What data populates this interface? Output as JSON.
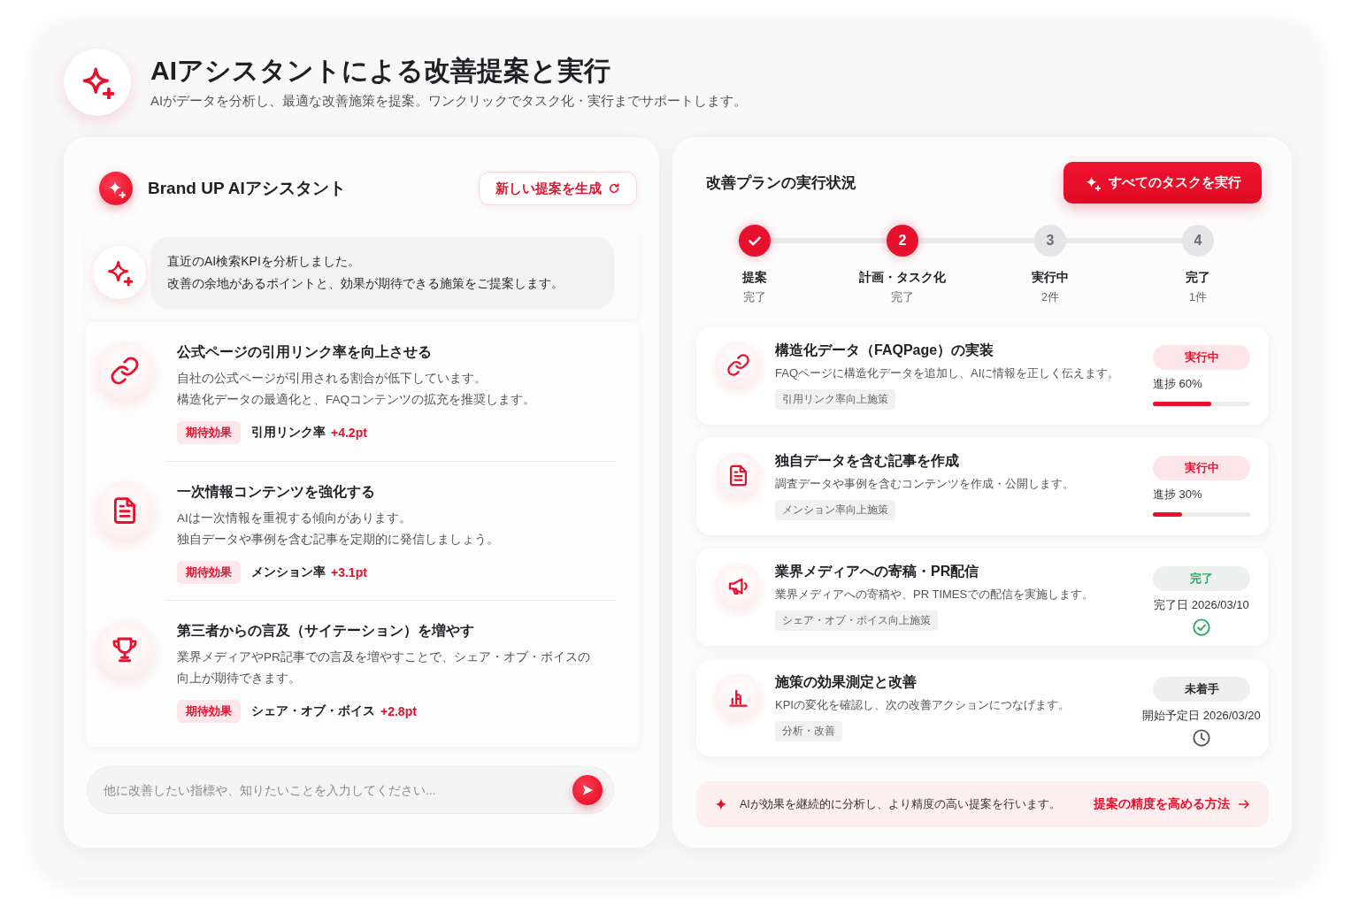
{
  "header": {
    "title": "AIアシスタントによる改善提案と実行",
    "subtitle": "AIがデータを分析し、最適な改善施策を提案。ワンクリックでタスク化・実行までサポートします。"
  },
  "assistant": {
    "name": "Brand UP AIアシスタント",
    "generate_button": "新しい提案を生成",
    "message": [
      "直近のAI検索KPIを分析しました。",
      "改善の余地があるポイントと、効果が期待できる施策をご提案します。"
    ],
    "suggestions": [
      {
        "title": "公式ページの引用リンク率を向上させる",
        "description": [
          "自社の公式ページが引用される割合が低下しています。",
          "構造化データの最適化と、FAQコンテンツの拡充を推奨します。"
        ],
        "effect_label": "期待効果",
        "metric": "引用リンク率",
        "delta": "+4.2pt"
      },
      {
        "title": "一次情報コンテンツを強化する",
        "description": [
          "AIは一次情報を重視する傾向があります。",
          "独自データや事例を含む記事を定期的に発信しましょう。"
        ],
        "effect_label": "期待効果",
        "metric": "メンション率",
        "delta": "+3.1pt"
      },
      {
        "title": "第三者からの言及（サイテーション）を増やす",
        "description": [
          "業界メディアやPR記事での言及を増やすことで、シェア・オブ・ボイスの向上が期待できます。"
        ],
        "effect_label": "期待効果",
        "metric": "シェア・オブ・ボイス",
        "delta": "+2.8pt"
      }
    ],
    "input": {
      "placeholder": "他に改善したい指標や、知りたいことを入力してください..."
    }
  },
  "plan": {
    "title": "改善プランの実行状況",
    "run_all_button": "すべてのタスクを実行",
    "steps": [
      {
        "done": true,
        "active": true,
        "label": "提案",
        "sub": "完了"
      },
      {
        "done": false,
        "active": true,
        "number": "2",
        "label": "計画・タスク化",
        "sub": "完了"
      },
      {
        "done": false,
        "active": false,
        "number": "3",
        "label": "実行中",
        "sub": "2件"
      },
      {
        "done": false,
        "active": false,
        "number": "4",
        "label": "完了",
        "sub": "1件"
      }
    ],
    "tasks": [
      {
        "kind": "progress",
        "title": "構造化データ（FAQPage）の実装",
        "description": "FAQページに構造化データを追加し、AIに情報を正しく伝えます。",
        "tag": "引用リンク率向上施策",
        "status": "実行中",
        "progress_label": "進捗 60%",
        "level": 0.6
      },
      {
        "kind": "progress",
        "title": "独自データを含む記事を作成",
        "description": "調査データや事例を含むコンテンツを作成・公開します。",
        "tag": "メンション率向上施策",
        "status": "実行中",
        "progress_label": "進捗 30%",
        "level": 0.3
      },
      {
        "kind": "done",
        "title": "業界メディアへの寄稿・PR配信",
        "description": "業界メディアへの寄稿や、PR TIMESでの配信を実施します。",
        "tag": "シェア・オブ・ボイス向上施策",
        "status": "完了",
        "date_label": "完了日 2026/03/10"
      },
      {
        "kind": "scheduled",
        "title": "施策の効果測定と改善",
        "description": "KPIの変化を確認し、次の改善アクションにつなげます。",
        "tag": "分析・改善",
        "status": "未着手",
        "date_label": "開始予定日 2026/03/20"
      }
    ],
    "note": {
      "text": "AIが効果を継続的に分析し、より精度の高い提案を行います。",
      "link": "提案の精度を高める方法"
    }
  }
}
